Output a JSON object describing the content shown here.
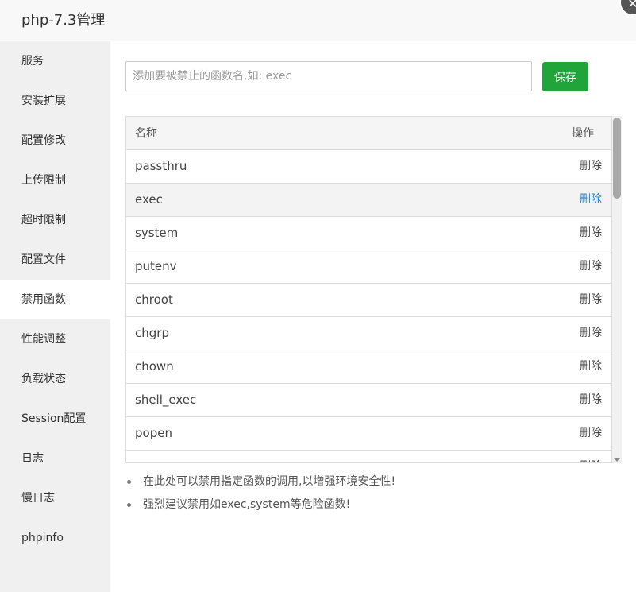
{
  "window": {
    "title": "php-7.3管理",
    "close_icon": "✕"
  },
  "sidebar": {
    "items": [
      {
        "label": "服务"
      },
      {
        "label": "安装扩展"
      },
      {
        "label": "配置修改"
      },
      {
        "label": "上传限制"
      },
      {
        "label": "超时限制"
      },
      {
        "label": "配置文件"
      },
      {
        "label": "禁用函数",
        "active": true
      },
      {
        "label": "性能调整"
      },
      {
        "label": "负载状态"
      },
      {
        "label": "Session配置"
      },
      {
        "label": "日志"
      },
      {
        "label": "慢日志"
      },
      {
        "label": "phpinfo"
      }
    ]
  },
  "form": {
    "input_placeholder": "添加要被禁止的函数名,如: exec",
    "input_value": "",
    "save_label": "保存"
  },
  "table": {
    "headers": {
      "name": "名称",
      "action": "操作"
    },
    "rows": [
      {
        "name": "passthru",
        "action": "删除"
      },
      {
        "name": "exec",
        "action": "删除"
      },
      {
        "name": "system",
        "action": "删除"
      },
      {
        "name": "putenv",
        "action": "删除"
      },
      {
        "name": "chroot",
        "action": "删除"
      },
      {
        "name": "chgrp",
        "action": "删除"
      },
      {
        "name": "chown",
        "action": "删除"
      },
      {
        "name": "shell_exec",
        "action": "删除"
      },
      {
        "name": "popen",
        "action": "删除"
      },
      {
        "name": "",
        "action": "删除"
      }
    ]
  },
  "tips": [
    "在此处可以禁用指定函数的调用,以增强环境安全性!",
    "强烈建议禁用如exec,system等危险函数!"
  ],
  "colors": {
    "accent": "#20a53a",
    "link_hover": "#2b7cc5"
  }
}
